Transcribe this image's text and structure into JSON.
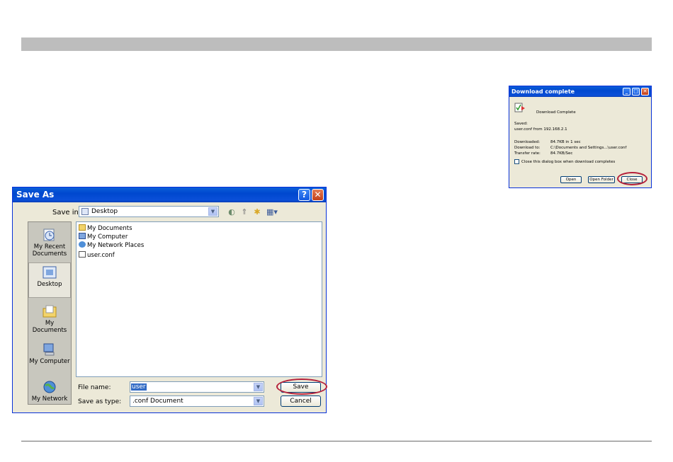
{
  "save_dialog": {
    "title": "Save As",
    "title_buttons": {
      "help": "?",
      "close": "✕"
    },
    "save_in_label": "Save in:",
    "save_in_value": "Desktop",
    "places": [
      {
        "label": "My Recent Documents",
        "icon": "recent-documents-icon"
      },
      {
        "label": "Desktop",
        "icon": "desktop-icon"
      },
      {
        "label": "My Documents",
        "icon": "my-documents-icon"
      },
      {
        "label": "My Computer",
        "icon": "my-computer-icon"
      },
      {
        "label": "My Network",
        "icon": "my-network-icon"
      }
    ],
    "files": [
      {
        "name": "My Documents",
        "icon": "folder-icon"
      },
      {
        "name": "My Computer",
        "icon": "computer-icon"
      },
      {
        "name": "My Network Places",
        "icon": "network-icon"
      },
      {
        "name": "user.conf",
        "icon": "file-icon"
      }
    ],
    "file_name_label": "File name:",
    "file_name_value": "user",
    "save_as_type_label": "Save as type:",
    "save_as_type_value": ".conf Document",
    "save_button": "Save",
    "cancel_button": "Cancel",
    "highlight_color": "#b5203a"
  },
  "download_dialog": {
    "title": "Download complete",
    "heading": "Download Complete",
    "saved_label": "Saved:",
    "saved_value": "user.conf from 192.168.2.1",
    "rows": [
      {
        "label": "Downloaded:",
        "value": "84.7KB in 1 sec"
      },
      {
        "label": "Download to:",
        "value": "C:\\Documents and Settings...\\user.conf"
      },
      {
        "label": "Transfer rate:",
        "value": "84.7KB/Sec"
      }
    ],
    "close_checkbox_label": "Close this dialog box when download completes",
    "close_checkbox_checked": false,
    "open_button": "Open",
    "open_folder_button": "Open Folder",
    "close_button": "Close"
  }
}
